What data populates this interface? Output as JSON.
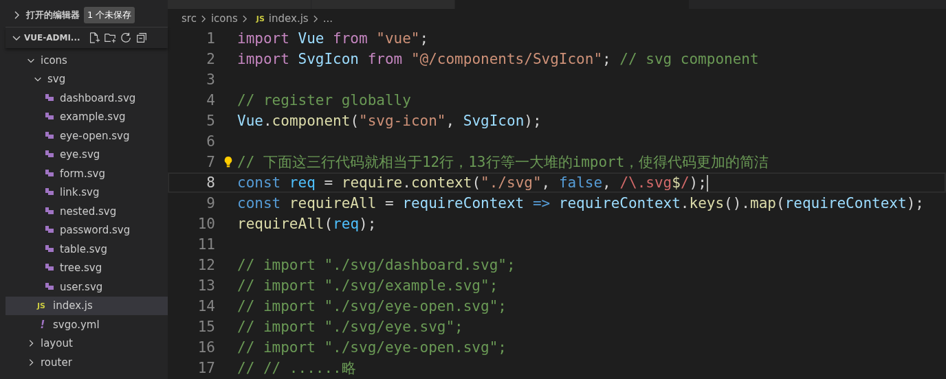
{
  "sidebar": {
    "open_editors": {
      "label": "打开的编辑器",
      "badge": "1 个未保存",
      "expanded": false
    },
    "project": {
      "label": "VUE-ADMI...",
      "expanded": true
    },
    "tree": [
      {
        "name": "icons",
        "kind": "folder",
        "expanded": true,
        "selected": false,
        "children": [
          {
            "name": "svg",
            "kind": "folder",
            "expanded": true,
            "selected": false,
            "children": [
              {
                "name": "dashboard.svg",
                "kind": "svg",
                "selected": false
              },
              {
                "name": "example.svg",
                "kind": "svg",
                "selected": false
              },
              {
                "name": "eye-open.svg",
                "kind": "svg",
                "selected": false
              },
              {
                "name": "eye.svg",
                "kind": "svg",
                "selected": false
              },
              {
                "name": "form.svg",
                "kind": "svg",
                "selected": false
              },
              {
                "name": "link.svg",
                "kind": "svg",
                "selected": false
              },
              {
                "name": "nested.svg",
                "kind": "svg",
                "selected": false
              },
              {
                "name": "password.svg",
                "kind": "svg",
                "selected": false
              },
              {
                "name": "table.svg",
                "kind": "svg",
                "selected": false
              },
              {
                "name": "tree.svg",
                "kind": "svg",
                "selected": false
              },
              {
                "name": "user.svg",
                "kind": "svg",
                "selected": false
              }
            ]
          },
          {
            "name": "index.js",
            "kind": "js",
            "icon_label": "JS",
            "selected": true
          },
          {
            "name": "svgo.yml",
            "kind": "yml",
            "icon_label": "!",
            "selected": false
          }
        ]
      },
      {
        "name": "layout",
        "kind": "folder",
        "expanded": false,
        "selected": false
      },
      {
        "name": "router",
        "kind": "folder",
        "expanded": false,
        "selected": false
      }
    ]
  },
  "tabs": [
    {
      "selected": false
    },
    {
      "selected": false
    },
    {
      "selected": true
    }
  ],
  "breadcrumb": [
    {
      "label": "src"
    },
    {
      "label": "icons"
    },
    {
      "label": "index.js",
      "icon_label": "JS"
    },
    {
      "label": "..."
    }
  ],
  "editor": {
    "lines": [
      {
        "number": "1",
        "active": false,
        "hint": false,
        "tokens": [
          {
            "text": "import",
            "kind": "keyword"
          },
          {
            "text": " Vue",
            "kind": "variable"
          },
          {
            "text": " from",
            "kind": "keyword"
          },
          {
            "text": " \"vue\"",
            "kind": "string"
          },
          {
            "text": ";",
            "kind": "plain"
          }
        ]
      },
      {
        "number": "2",
        "active": false,
        "hint": false,
        "tokens": [
          {
            "text": "import",
            "kind": "keyword"
          },
          {
            "text": " SvgIcon",
            "kind": "variable"
          },
          {
            "text": " from",
            "kind": "keyword"
          },
          {
            "text": " \"@/components/SvgIcon\"",
            "kind": "string"
          },
          {
            "text": ";",
            "kind": "plain"
          },
          {
            "text": " // svg component",
            "kind": "comment"
          }
        ]
      },
      {
        "number": "3",
        "active": false,
        "hint": false
      },
      {
        "number": "4",
        "active": false,
        "hint": false,
        "tokens": [
          {
            "text": "// register globally",
            "kind": "comment"
          }
        ]
      },
      {
        "number": "5",
        "active": false,
        "hint": false,
        "tokens": [
          {
            "text": "Vue",
            "kind": "variable"
          },
          {
            "text": ".",
            "kind": "plain"
          },
          {
            "text": "component",
            "kind": "function"
          },
          {
            "text": "(",
            "kind": "plain"
          },
          {
            "text": "\"svg-icon\"",
            "kind": "string"
          },
          {
            "text": ",",
            "kind": "plain"
          },
          {
            "text": " SvgIcon",
            "kind": "variable"
          },
          {
            "text": ");",
            "kind": "plain"
          }
        ]
      },
      {
        "number": "6",
        "active": false,
        "hint": false
      },
      {
        "number": "7",
        "active": false,
        "hint": true,
        "tokens": [
          {
            "text": "// 下面这三行代码就相当于12行，13行等一大堆的import，使得代码更加的简洁",
            "kind": "comment"
          }
        ]
      },
      {
        "number": "8",
        "active": true,
        "hint": false,
        "tokens": [
          {
            "text": "const",
            "kind": "declaration"
          },
          {
            "text": " req",
            "kind": "constant"
          },
          {
            "text": " =",
            "kind": "plain"
          },
          {
            "text": " require",
            "kind": "function"
          },
          {
            "text": ".",
            "kind": "plain"
          },
          {
            "text": "context",
            "kind": "function"
          },
          {
            "text": "(",
            "kind": "plain"
          },
          {
            "text": "\"./svg\"",
            "kind": "string"
          },
          {
            "text": ",",
            "kind": "plain"
          },
          {
            "text": " false",
            "kind": "declaration"
          },
          {
            "text": ",",
            "kind": "plain"
          },
          {
            "text": " /\\.svg",
            "kind": "regex"
          },
          {
            "text": "$",
            "kind": "function"
          },
          {
            "text": "/",
            "kind": "regex"
          },
          {
            "text": ");",
            "kind": "plain"
          }
        ]
      },
      {
        "number": "9",
        "active": false,
        "hint": false,
        "tokens": [
          {
            "text": "const",
            "kind": "declaration"
          },
          {
            "text": " requireAll",
            "kind": "function"
          },
          {
            "text": " =",
            "kind": "plain"
          },
          {
            "text": " requireContext",
            "kind": "variable"
          },
          {
            "text": " =>",
            "kind": "declaration"
          },
          {
            "text": " requireContext",
            "kind": "variable"
          },
          {
            "text": ".",
            "kind": "plain"
          },
          {
            "text": "keys",
            "kind": "function"
          },
          {
            "text": "().",
            "kind": "plain"
          },
          {
            "text": "map",
            "kind": "function"
          },
          {
            "text": "(",
            "kind": "plain"
          },
          {
            "text": "requireContext",
            "kind": "variable"
          },
          {
            "text": ");",
            "kind": "plain"
          }
        ]
      },
      {
        "number": "10",
        "active": false,
        "hint": false,
        "tokens": [
          {
            "text": "requireAll",
            "kind": "function"
          },
          {
            "text": "(",
            "kind": "plain"
          },
          {
            "text": "req",
            "kind": "constant"
          },
          {
            "text": ");",
            "kind": "plain"
          }
        ]
      },
      {
        "number": "11",
        "active": false,
        "hint": false
      },
      {
        "number": "12",
        "active": false,
        "hint": false,
        "tokens": [
          {
            "text": "// import \"./svg/dashboard.svg\";",
            "kind": "comment"
          }
        ]
      },
      {
        "number": "13",
        "active": false,
        "hint": false,
        "tokens": [
          {
            "text": "// import \"./svg/example.svg\";",
            "kind": "comment"
          }
        ]
      },
      {
        "number": "14",
        "active": false,
        "hint": false,
        "tokens": [
          {
            "text": "// import \"./svg/eye-open.svg\";",
            "kind": "comment"
          }
        ]
      },
      {
        "number": "15",
        "active": false,
        "hint": false,
        "tokens": [
          {
            "text": "// import \"./svg/eye.svg\";",
            "kind": "comment"
          }
        ]
      },
      {
        "number": "16",
        "active": false,
        "hint": false,
        "tokens": [
          {
            "text": "// import \"./svg/eye-open.svg\";",
            "kind": "comment"
          }
        ]
      },
      {
        "number": "17",
        "active": false,
        "hint": false,
        "tokens": [
          {
            "text": "// // ......略",
            "kind": "comment"
          }
        ]
      }
    ]
  }
}
